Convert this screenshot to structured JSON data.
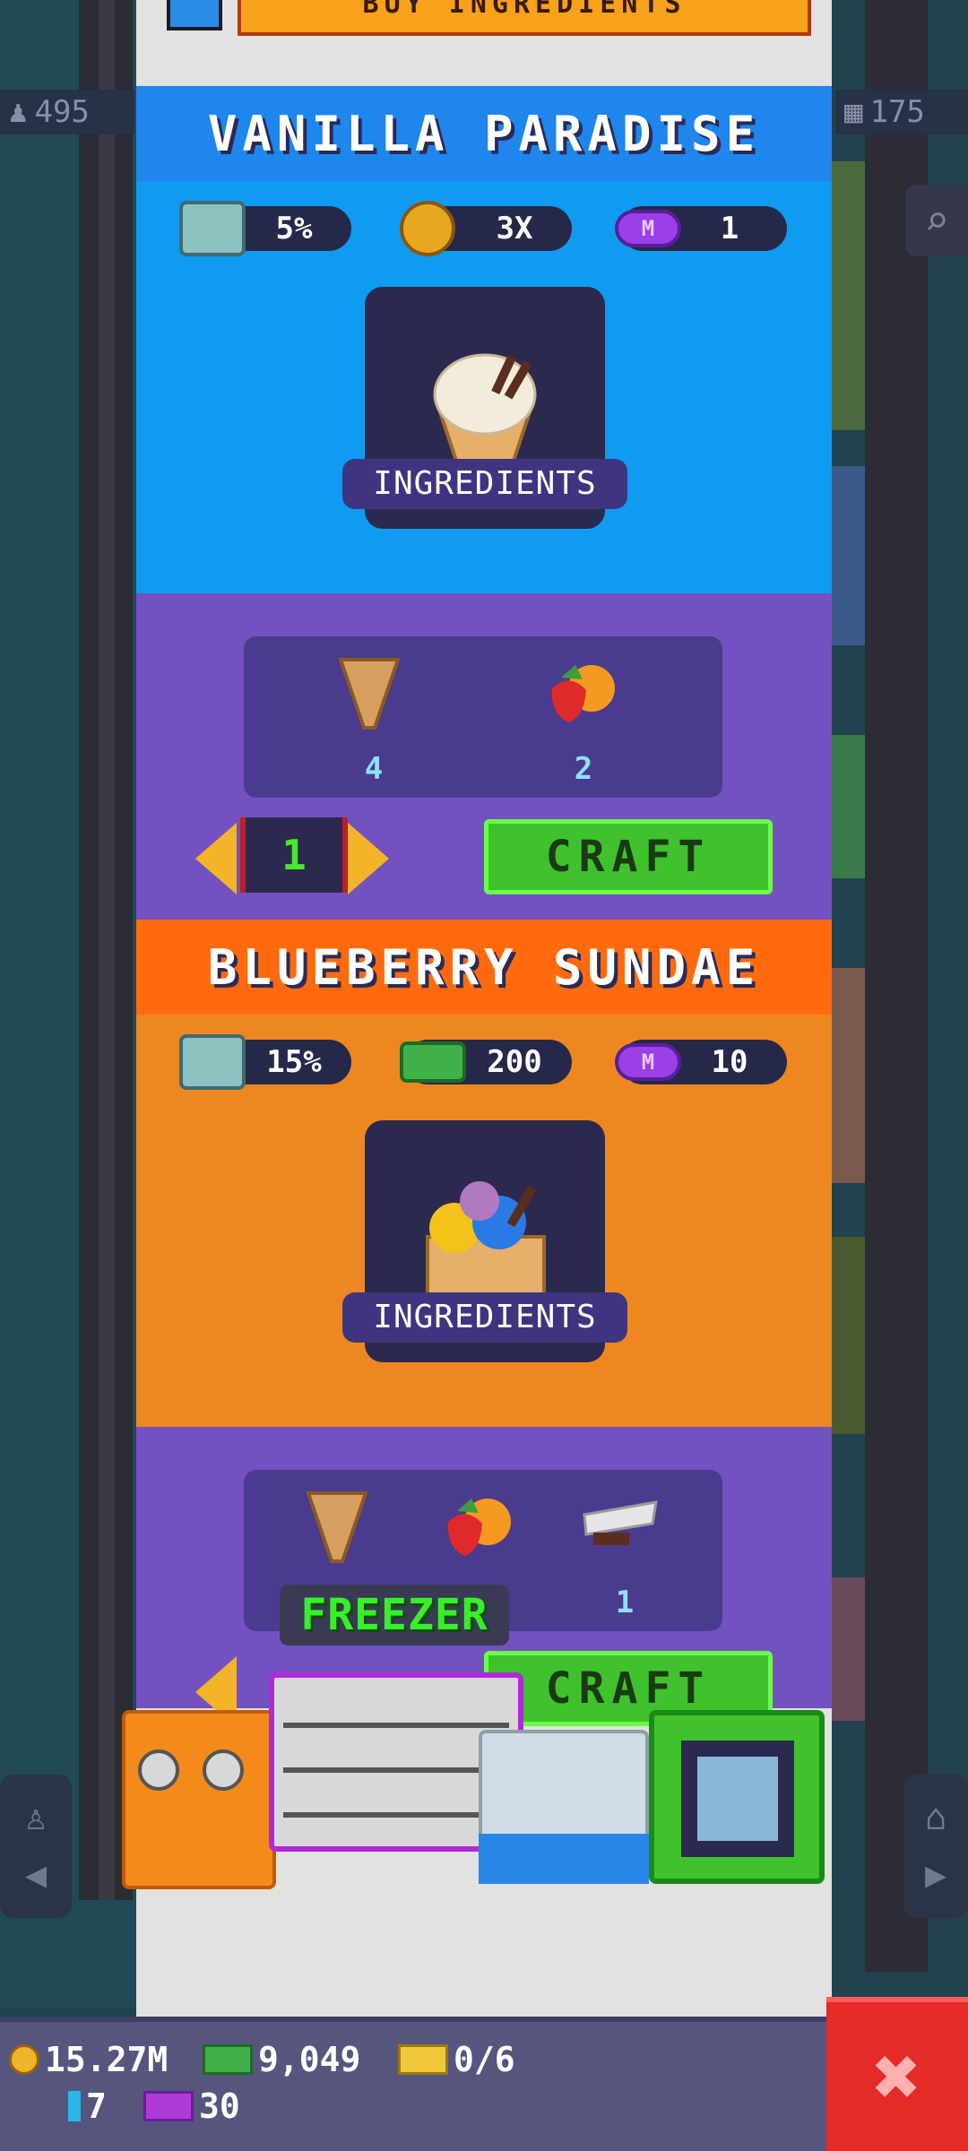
{
  "top_bar": {
    "buy_label": "BUY INGREDIENTS"
  },
  "floor_stats": {
    "left": "495",
    "right": "175"
  },
  "recipes": [
    {
      "name": "VANILLA PARADISE",
      "header_color": "#1e86ec",
      "hero_color": "#0f9cf0",
      "stats": [
        {
          "icon": "device-icon",
          "value": "5%"
        },
        {
          "icon": "coin-icon",
          "value": "3X"
        },
        {
          "icon": "gem-icon",
          "value": "1"
        }
      ],
      "ingredients_label": "INGREDIENTS",
      "ingredients": [
        {
          "icon": "cone-icon",
          "qty": "4"
        },
        {
          "icon": "fruit-icon",
          "qty": "2"
        }
      ],
      "quantity": "1",
      "craft_label": "CRAFT"
    },
    {
      "name": "BLUEBERRY SUNDAE",
      "header_color": "#ff6a0f",
      "hero_color": "#ee8722",
      "stats": [
        {
          "icon": "device-icon",
          "value": "15%"
        },
        {
          "icon": "cash-icon",
          "value": "200"
        },
        {
          "icon": "gem-icon",
          "value": "10"
        }
      ],
      "ingredients_label": "INGREDIENTS",
      "ingredients": [
        {
          "icon": "cone-icon",
          "qty": ""
        },
        {
          "icon": "fruit-icon",
          "qty": ""
        },
        {
          "icon": "chocolate-icon",
          "qty": "1"
        }
      ],
      "craft_label": "CRAFT"
    }
  ],
  "freezer_label": "FREEZER",
  "resources": {
    "coins": "15.27M",
    "cash": "9,049",
    "tickets": "0/6",
    "blue_items": "7",
    "gems": "30"
  },
  "colors": {
    "accent_green": "#3fc22e",
    "panel_purple": "#7351c0",
    "close_red": "#e52a2a"
  }
}
